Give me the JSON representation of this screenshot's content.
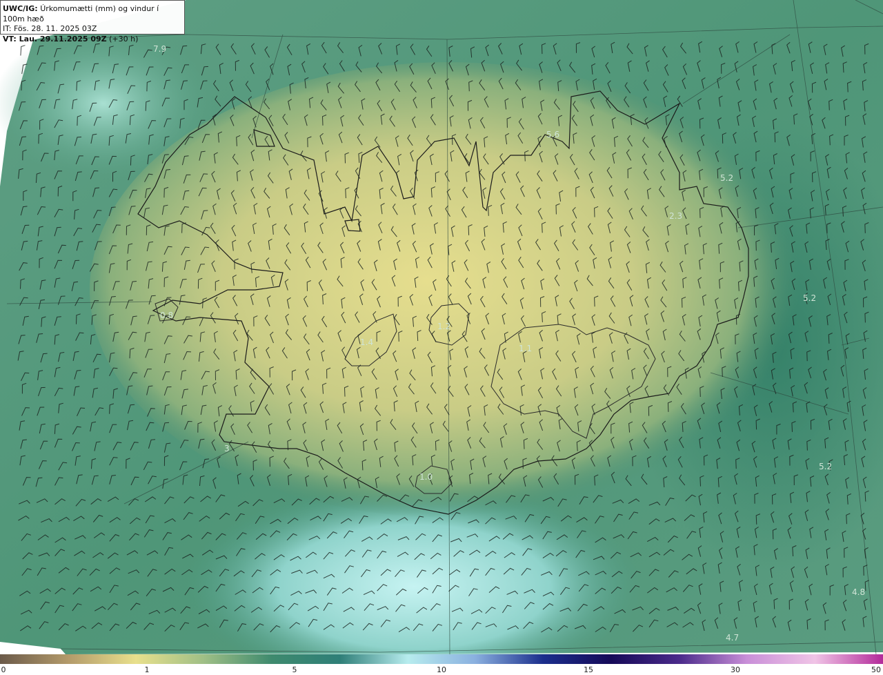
{
  "header": {
    "product": "UWC/IG:",
    "description": "Úrkomumætti (mm) og vindur í 100m hæð",
    "initial_time": "IT: Fös. 28. 11. 2025 03Z",
    "valid_time": "VT: Lau. 29.11.2025 09Z",
    "lead_time": "(+30 h)"
  },
  "map_labels": [
    {
      "id": "nw-sea",
      "text": "7.9"
    },
    {
      "id": "north",
      "text": "5.6"
    },
    {
      "id": "ne",
      "text": "5.2"
    },
    {
      "id": "east-coast",
      "text": "2.3"
    },
    {
      "id": "east-sea",
      "text": "5.2"
    },
    {
      "id": "snaefells",
      "text": "0.8"
    },
    {
      "id": "langjokull",
      "text": "1.4"
    },
    {
      "id": "hofsjokull",
      "text": "1.2"
    },
    {
      "id": "vatnajokull",
      "text": "1.1"
    },
    {
      "id": "se-sea",
      "text": "5.2"
    },
    {
      "id": "reykjanes",
      "text": "3"
    },
    {
      "id": "myrdalsjokull",
      "text": "1.0"
    },
    {
      "id": "se-far",
      "text": "4.8"
    },
    {
      "id": "s-far",
      "text": "4.7"
    }
  ],
  "colorbar": {
    "ticks": [
      "0",
      "1",
      "5",
      "10",
      "15",
      "30",
      "50"
    ],
    "colors": [
      "#6b5a4a",
      "#b39a6a",
      "#e8e08c",
      "#9fbf86",
      "#3e8a6e",
      "#2f7f78",
      "#b7ecee",
      "#8ab0df",
      "#1b2e8c",
      "#160a58",
      "#4a2a8a",
      "#c98fd8",
      "#f0c4e6",
      "#b32a9a"
    ]
  }
}
